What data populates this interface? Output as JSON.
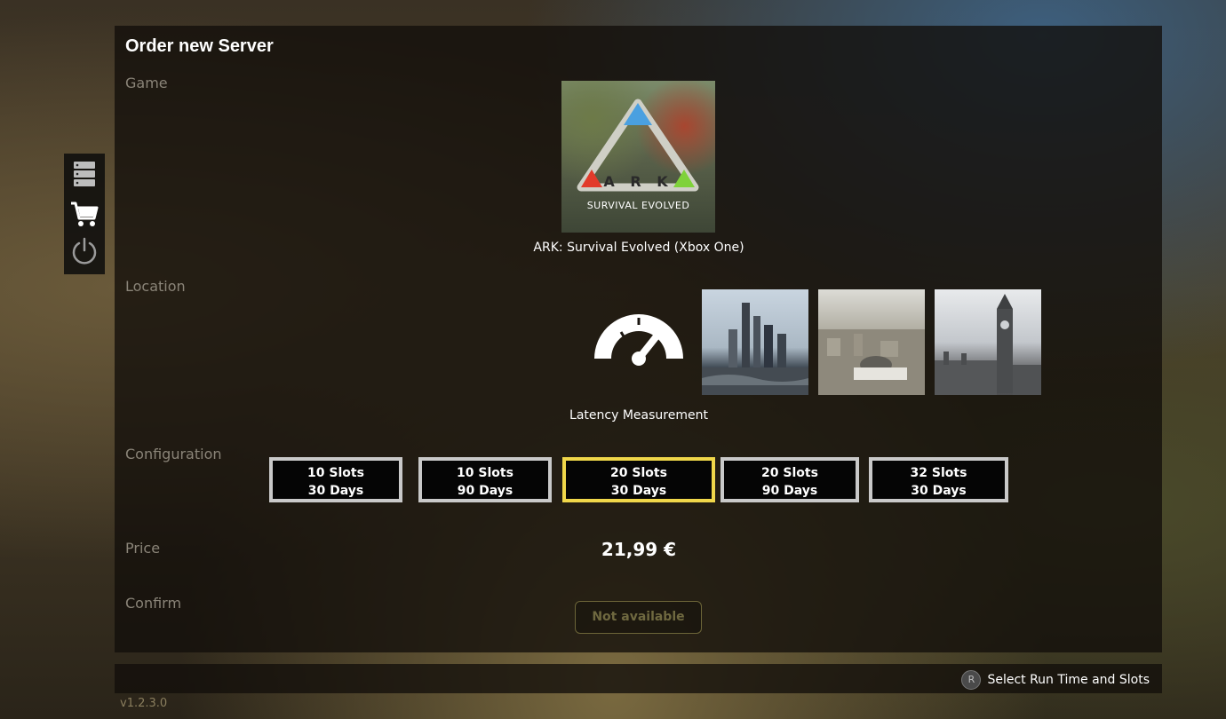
{
  "page": {
    "title": "Order new Server"
  },
  "sections": {
    "game": "Game",
    "location": "Location",
    "configuration": "Configuration",
    "price": "Price",
    "confirm": "Confirm"
  },
  "game": {
    "tile_logo_text": "A R K",
    "tile_subtitle": "SURVIVAL EVOLVED",
    "name": "ARK: Survival Evolved (Xbox One)"
  },
  "location": {
    "latency_label": "Latency Measurement",
    "options": [
      {
        "icon": "city-frankfurt-image"
      },
      {
        "icon": "city-skyline-image"
      },
      {
        "icon": "city-london-image"
      }
    ]
  },
  "configuration": {
    "options": [
      {
        "slots": "10 Slots",
        "days": "30 Days",
        "selected": false
      },
      {
        "slots": "10 Slots",
        "days": "90 Days",
        "selected": false
      },
      {
        "slots": "20 Slots",
        "days": "30 Days",
        "selected": true
      },
      {
        "slots": "20 Slots",
        "days": "90 Days",
        "selected": false
      },
      {
        "slots": "32 Slots",
        "days": "30 Days",
        "selected": false
      }
    ]
  },
  "price": {
    "value": "21,99 €"
  },
  "confirm": {
    "label": "Not available"
  },
  "sidebar": {
    "items": [
      {
        "icon": "server-icon"
      },
      {
        "icon": "cart-icon"
      },
      {
        "icon": "power-icon"
      }
    ]
  },
  "footer": {
    "hint_button": "R",
    "hint_text": "Select Run Time and Slots",
    "version": "v1.2.3.0"
  },
  "colors": {
    "selected_border": "#f0d74a",
    "default_border": "#c9c9c9",
    "disabled_text": "#6f6940"
  }
}
